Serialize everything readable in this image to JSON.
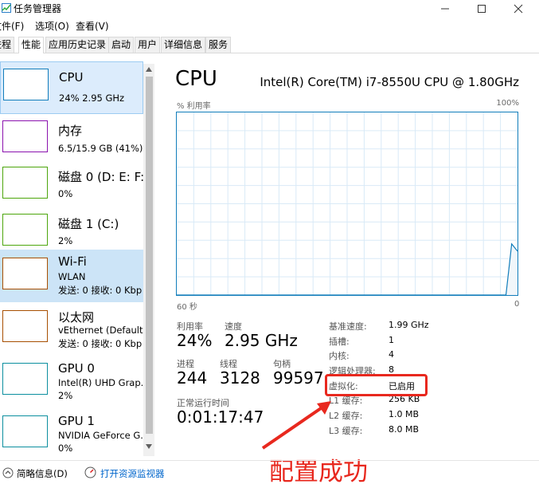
{
  "window": {
    "title": "任务管理器"
  },
  "menu": [
    "文件(F)",
    "选项(O)",
    "查看(V)"
  ],
  "tabs": [
    "进程",
    "性能",
    "应用历史记录",
    "启动",
    "用户",
    "详细信息",
    "服务"
  ],
  "sidebar": [
    {
      "name": "CPU",
      "sub1": "24% 2.95 GHz",
      "sub2": "",
      "color": "#117dbb"
    },
    {
      "name": "内存",
      "sub1": "6.5/15.9 GB (41%)",
      "sub2": "",
      "color": "#8b12ae"
    },
    {
      "name": "磁盘 0 (D: E: F:",
      "sub1": "0%",
      "sub2": "",
      "color": "#4da60c"
    },
    {
      "name": "磁盘 1 (C:)",
      "sub1": "2%",
      "sub2": "",
      "color": "#4da60c"
    },
    {
      "name": "Wi-Fi",
      "sub1": "WLAN",
      "sub2": "发送: 0 接收: 0 Kbp",
      "color": "#a74f01"
    },
    {
      "name": "以太网",
      "sub1": "vEthernet (Default",
      "sub2": "发送: 0 接收: 0 Kbp",
      "color": "#a74f01"
    },
    {
      "name": "GPU 0",
      "sub1": "Intel(R) UHD Grap...",
      "sub2": "2%",
      "color": "#0c8f9f"
    },
    {
      "name": "GPU 1",
      "sub1": "NVIDIA GeForce G...",
      "sub2": "0%",
      "color": "#0c8f9f"
    }
  ],
  "main": {
    "title": "CPU",
    "model": "Intel(R) Core(TM) i7-8550U CPU @ 1.80GHz",
    "graph_label_left": "% 利用率",
    "graph_label_right": "100%",
    "graph_time_left": "60 秒",
    "graph_time_right": "0",
    "graph_color": "#117dbb",
    "graph_values": [
      0,
      0,
      0,
      0,
      0,
      0,
      0,
      0,
      0,
      0,
      0,
      0,
      0,
      0,
      0,
      0,
      0,
      0,
      0,
      0,
      0,
      0,
      0,
      0,
      0,
      0,
      0,
      0,
      0,
      0,
      0,
      0,
      0,
      0,
      0,
      0,
      0,
      0,
      0,
      0,
      0,
      0,
      0,
      0,
      0,
      0,
      0,
      0,
      0,
      0,
      0,
      0,
      0,
      0,
      0,
      0,
      0,
      0,
      28,
      24
    ]
  },
  "stats": {
    "util_label": "利用率",
    "util_value": "24%",
    "speed_label": "速度",
    "speed_value": "2.95 GHz",
    "proc_label": "进程",
    "proc_value": "244",
    "thread_label": "线程",
    "thread_value": "3128",
    "handle_label": "句柄",
    "handle_value": "99597",
    "uptime_label": "正常运行时间",
    "uptime_value": "0:01:17:47"
  },
  "specs": [
    {
      "label": "基准速度:",
      "value": "1.99 GHz"
    },
    {
      "label": "插槽:",
      "value": "1"
    },
    {
      "label": "内核:",
      "value": "4"
    },
    {
      "label": "逻辑处理器:",
      "value": "8"
    },
    {
      "label": "虚拟化:",
      "value": "已启用"
    },
    {
      "label": "L1 缓存:",
      "value": "256 KB"
    },
    {
      "label": "L2 缓存:",
      "value": "1.0 MB"
    },
    {
      "label": "L3 缓存:",
      "value": "8.0 MB"
    }
  ],
  "annotation": "配置成功",
  "footer": {
    "summary": "简略信息(D)",
    "resmon": "打开资源监视器"
  }
}
